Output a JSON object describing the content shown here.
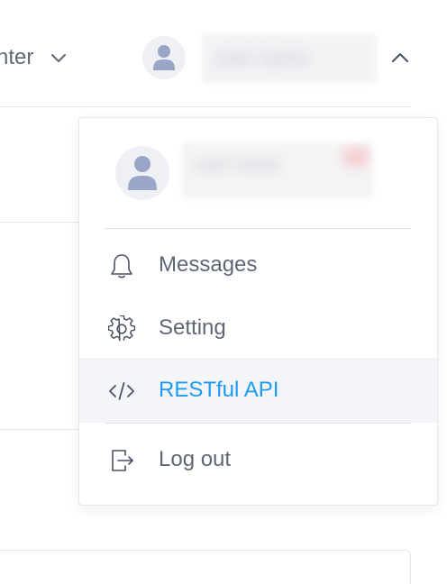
{
  "header": {
    "partial_menu_label": "nter",
    "username": "user name"
  },
  "dropdown": {
    "profile": {
      "display_name": "user name"
    },
    "items": [
      {
        "label": "Messages",
        "icon": "bell-icon",
        "active": false
      },
      {
        "label": "Setting",
        "icon": "gear-icon",
        "active": false
      },
      {
        "label": "RESTful API",
        "icon": "code-icon",
        "active": true
      },
      {
        "label": "Log out",
        "icon": "logout-icon",
        "active": false
      }
    ]
  },
  "colors": {
    "accent": "#1d9bf0",
    "text": "#5f6774",
    "avatar_bg": "#eef0f6",
    "avatar_fg": "#9aa6c8",
    "active_bg": "#f4f5f9"
  }
}
